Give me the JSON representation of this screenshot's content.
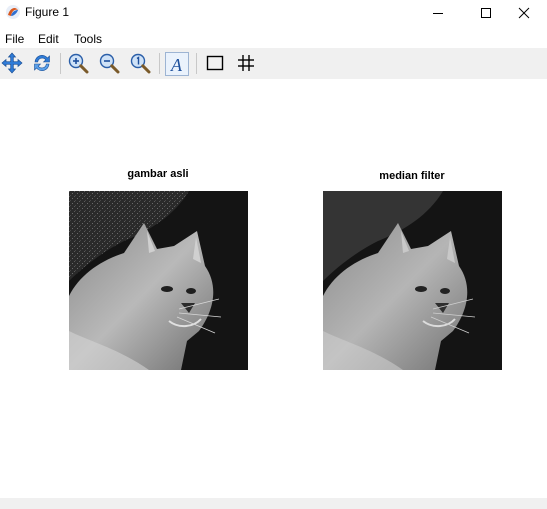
{
  "window": {
    "title": "Figure 1"
  },
  "menu": {
    "items": [
      {
        "label": "File"
      },
      {
        "label": "Edit"
      },
      {
        "label": "Tools"
      }
    ]
  },
  "toolbar": {
    "tools": [
      {
        "icon": "pan-icon"
      },
      {
        "icon": "rotate-icon"
      },
      {
        "icon": "zoom-in-icon"
      },
      {
        "icon": "zoom-out-icon"
      },
      {
        "icon": "zoom-reset-icon"
      },
      {
        "icon": "text-insert-icon"
      },
      {
        "icon": "rectangle-icon"
      },
      {
        "icon": "grid-icon"
      }
    ]
  },
  "figure": {
    "panels": [
      {
        "title": "gambar asli"
      },
      {
        "title": "median filter"
      }
    ]
  },
  "colors": {
    "accent": "#1e6fd9",
    "toolbar_bg": "#f0f0f0",
    "image_bg": "#141414"
  }
}
